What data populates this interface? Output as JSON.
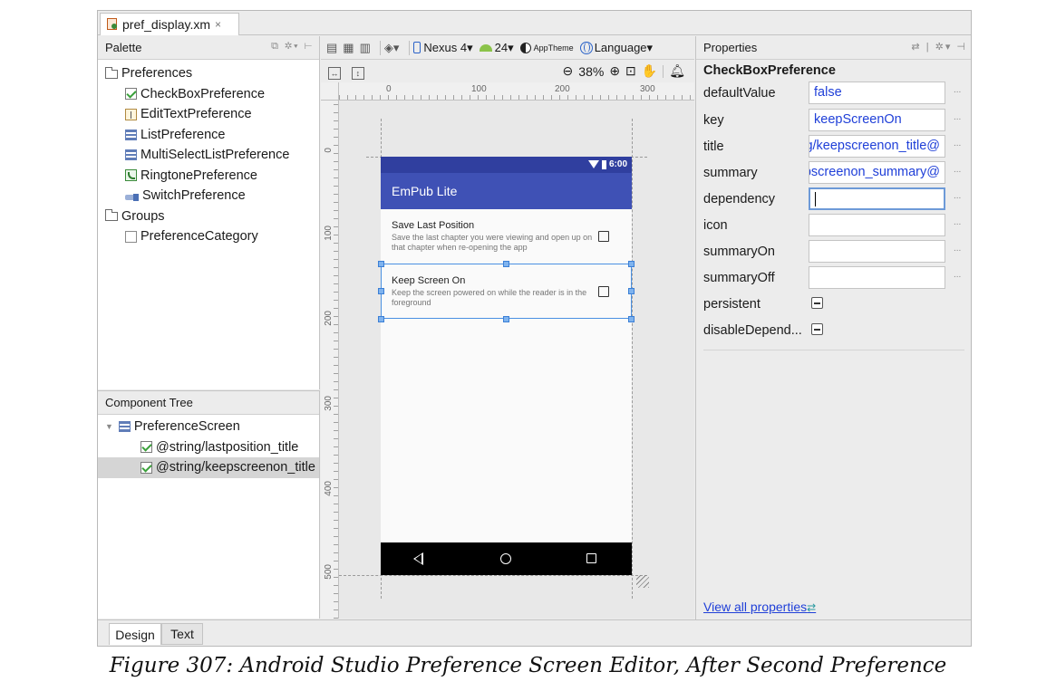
{
  "file_tab": {
    "name": "pref_display.xm",
    "close": "×"
  },
  "palette": {
    "title": "Palette",
    "header_icons": "⧉ ✲▾ ⊢",
    "items": [
      {
        "label": "Preferences",
        "icon": "folder-icon",
        "level": 0
      },
      {
        "label": "CheckBoxPreference",
        "icon": "checkbox-icon",
        "level": 1
      },
      {
        "label": "EditTextPreference",
        "icon": "edittext-icon",
        "level": 1
      },
      {
        "label": "ListPreference",
        "icon": "list-icon",
        "level": 1
      },
      {
        "label": "MultiSelectListPreference",
        "icon": "list-icon",
        "level": 1
      },
      {
        "label": "RingtonePreference",
        "icon": "ringtone-icon",
        "level": 1
      },
      {
        "label": "SwitchPreference",
        "icon": "switch-icon",
        "level": 1
      },
      {
        "label": "Groups",
        "icon": "folder-icon",
        "level": 0
      },
      {
        "label": "PreferenceCategory",
        "icon": "category-icon",
        "level": 1
      }
    ]
  },
  "component_tree": {
    "title": "Component Tree",
    "items": [
      {
        "label": "PreferenceScreen",
        "level": 0
      },
      {
        "label": "@string/lastposition_title",
        "level": 1
      },
      {
        "label": "@string/keepscreenon_title",
        "level": 1,
        "selected": true
      }
    ]
  },
  "toolbar": {
    "device": "Nexus 4",
    "api": "24",
    "theme": "AppTheme",
    "language": "Language",
    "dropdown": "▾",
    "zoom": "38%"
  },
  "canvas": {
    "ruler_top": [
      "0",
      "100",
      "200",
      "300"
    ],
    "ruler_left": [
      "0",
      "100",
      "200",
      "300",
      "400",
      "500"
    ]
  },
  "preview": {
    "time": "6:00",
    "app_title": "EmPub Lite",
    "prefs": [
      {
        "title": "Save Last Position",
        "summary": "Save the last chapter you were viewing and open up on that chapter when re-opening the app"
      },
      {
        "title": "Keep Screen On",
        "summary": "Keep the screen powered on while the reader is in the foreground"
      }
    ]
  },
  "properties": {
    "title": "Properties",
    "header_icons": "⇄ | ✲▾ ⊣",
    "component": "CheckBoxPreference",
    "rows": [
      {
        "label": "defaultValue",
        "value": "false"
      },
      {
        "label": "key",
        "value": "keepScreenOn"
      },
      {
        "label": "title",
        "value": "@string/keepscreenon_title"
      },
      {
        "label": "summary",
        "value": "@string/keepscreenon_summary"
      },
      {
        "label": "dependency",
        "value": ""
      },
      {
        "label": "icon",
        "value": ""
      },
      {
        "label": "summaryOn",
        "value": ""
      },
      {
        "label": "summaryOff",
        "value": ""
      },
      {
        "label": "persistent",
        "value": ""
      },
      {
        "label": "disableDepend...",
        "value": ""
      }
    ],
    "more": "...",
    "view_all": "View all properties",
    "view_all_arrow": "⇄"
  },
  "bottom_tabs": {
    "design": "Design",
    "text": "Text"
  },
  "caption": "Figure 307: Android Studio Preference Screen Editor, After Second Preference"
}
